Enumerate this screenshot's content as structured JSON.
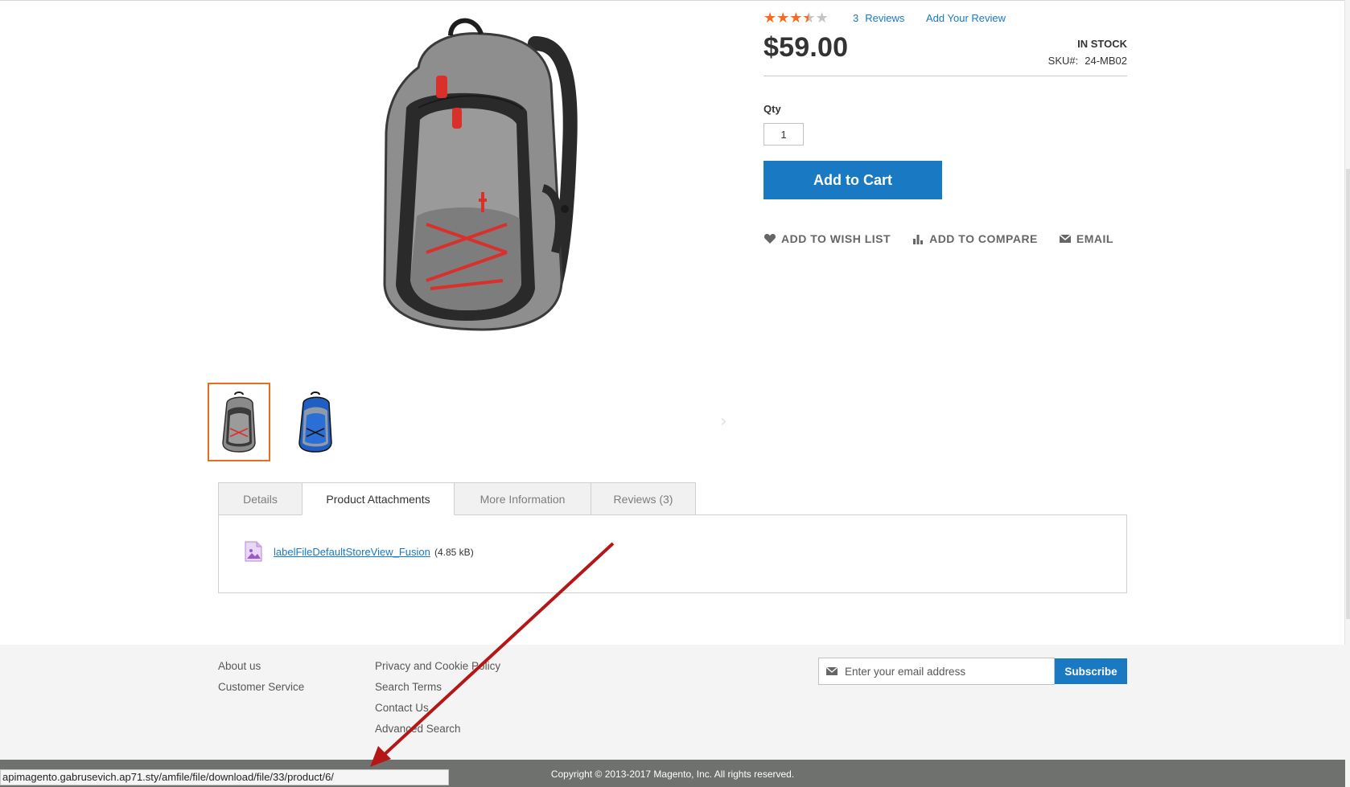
{
  "product": {
    "rating": {
      "value": 3.5,
      "max": 5
    },
    "reviews_count": "3",
    "reviews_label": "Reviews",
    "add_review_label": "Add Your Review",
    "price": "$59.00",
    "stock": "IN STOCK",
    "sku_label": "SKU#:",
    "sku_value": "24-MB02",
    "qty_label": "Qty",
    "qty_value": "1",
    "add_to_cart_label": "Add to Cart",
    "actions": {
      "wishlist": "ADD TO WISH LIST",
      "compare": "ADD TO COMPARE",
      "email": "EMAIL"
    }
  },
  "gallery": {
    "thumbnails": [
      {
        "color": "#8a8a8a",
        "accent": "#d9302b",
        "active": true
      },
      {
        "color": "#1f5fc4",
        "accent": "#1a1a1a",
        "active": false
      }
    ],
    "main_colors": {
      "body": "#8e8e8e",
      "panel": "#2a2a2a",
      "cord": "#d9302b"
    }
  },
  "tabs": [
    {
      "label": "Details",
      "active": false
    },
    {
      "label": "Product Attachments",
      "active": true
    },
    {
      "label": "More Information",
      "active": false
    },
    {
      "label": "Reviews (3)",
      "active": false
    }
  ],
  "attachment": {
    "name": "labelFileDefaultStoreView_Fusion ",
    "size": "(4.85 kB)",
    "icon": "image-file-icon"
  },
  "footer": {
    "col1": [
      "About us",
      "Customer Service"
    ],
    "col2": [
      "Privacy and Cookie Policy",
      "Search Terms",
      "Contact Us",
      "Advanced Search"
    ],
    "newsletter_placeholder": "Enter your email address",
    "subscribe_label": "Subscribe",
    "copyright": "Copyright © 2013-2017 Magento, Inc. All rights reserved."
  },
  "status_url": "apimagento.gabrusevich.ap71.sty/amfile/file/download/file/33/product/6/",
  "colors": {
    "accent": "#1979c3",
    "rating": "#f26c21",
    "thumb_active_border": "#e86d1f",
    "arrow": "#b51616"
  }
}
